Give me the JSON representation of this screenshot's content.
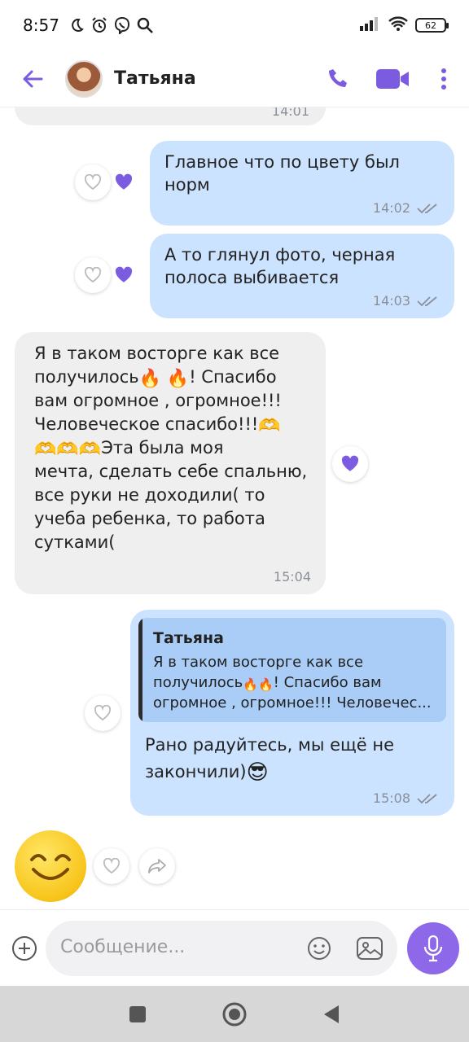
{
  "status_bar": {
    "time": "8:57",
    "battery": "62",
    "icons": [
      "moon-icon",
      "alarm-icon",
      "viber-icon",
      "search-icon",
      "signal-icon",
      "wifi-icon",
      "battery-icon"
    ]
  },
  "header": {
    "contact_name": "Татьяна",
    "icons": [
      "back-arrow-icon",
      "phone-icon",
      "video-camera-icon",
      "more-vertical-icon"
    ]
  },
  "colors": {
    "accent": "#7b5ce0",
    "incoming_bubble": "#efefef",
    "outgoing_bubble": "#cce3ff",
    "quote_background": "#a9cdf7"
  },
  "messages": [
    {
      "id": "m0",
      "direction": "in",
      "time": "14:01",
      "partial": true
    },
    {
      "id": "m1",
      "direction": "out",
      "text": "Главное что по цвету был норм",
      "time": "14:02",
      "status": "read",
      "reaction": "purple-heart"
    },
    {
      "id": "m2",
      "direction": "out",
      "text": "А то глянул фото, черная полоса выбивается",
      "time": "14:03",
      "status": "read",
      "reaction": "purple-heart"
    },
    {
      "id": "m3",
      "direction": "in",
      "time": "15:04",
      "reaction": "purple-heart",
      "lines": [
        "Я в таком восторге как все",
        "получилось",
        "! Спасибо",
        "вам огромное , огромное!!!",
        "Человеческое спасибо!!!",
        "Эта была моя",
        "мечта, сделать себе спальню,",
        "все руки не доходили( то",
        "учеба ребенка, то работа",
        "сутками("
      ]
    },
    {
      "id": "m4",
      "direction": "out",
      "time": "15:08",
      "status": "read",
      "quote": {
        "author": "Татьяна",
        "line1": "Я в таком восторге как все",
        "line2a": "получилось",
        "line2b": "! Спасибо вам",
        "line3": "огромное , огромное!!! Человечес..."
      },
      "line1": "Рано радуйтесь, мы ещё не",
      "line2": "закончили)"
    },
    {
      "id": "m5",
      "direction": "in",
      "sticker": "smiling-face-emoji"
    }
  ],
  "composer": {
    "placeholder": "Сообщение...",
    "icons": [
      "plus-icon",
      "smiley-icon",
      "gallery-icon",
      "microphone-icon"
    ]
  },
  "nav": {
    "icons": [
      "recents-square-icon",
      "home-circle-icon",
      "back-triangle-icon"
    ]
  }
}
